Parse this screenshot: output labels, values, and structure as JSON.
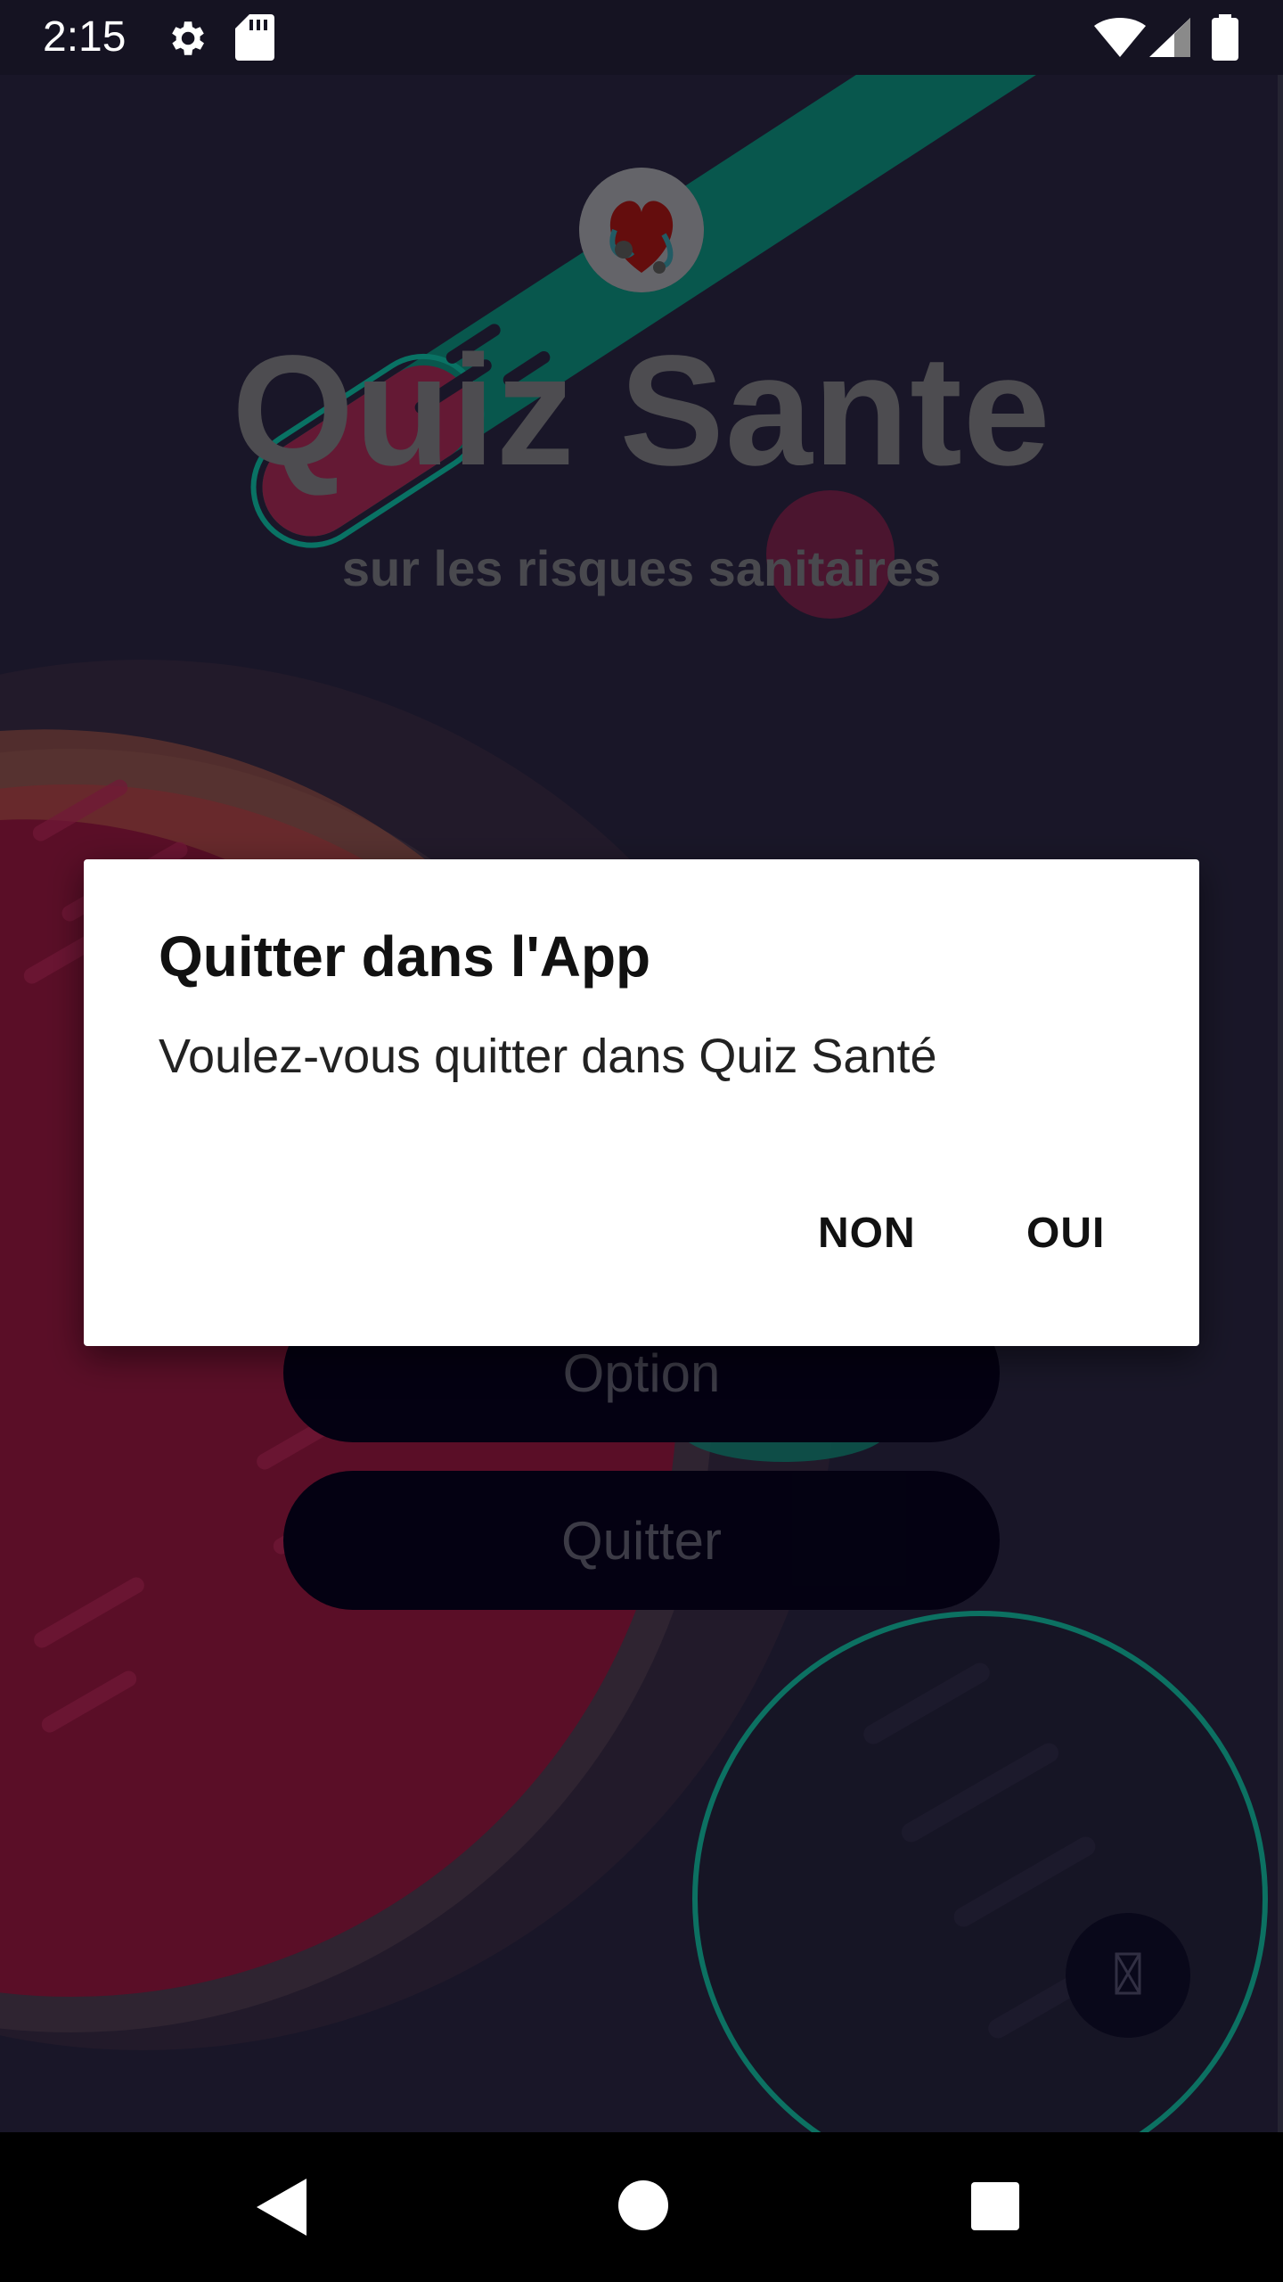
{
  "status_bar": {
    "time": "2:15",
    "icons": [
      "gear-icon",
      "sd-card-icon",
      "wifi-icon",
      "signal-icon",
      "battery-icon"
    ]
  },
  "app": {
    "title": "Quiz Sante",
    "subtitle": "sur les risques sanitaires",
    "buttons": {
      "option_label": "Option",
      "quit_label": "Quitter"
    },
    "fab_icon": "music-note-icon"
  },
  "dialog": {
    "title": "Quitter dans l'App",
    "message": "Voulez-vous quitter dans Quiz Santé",
    "negative_label": "NON",
    "positive_label": "OUI"
  },
  "nav_bar": {
    "buttons": [
      "back-icon",
      "home-icon",
      "recents-icon"
    ]
  },
  "colors": {
    "background": "#1f1c31",
    "accent_teal": "#0c7a6a",
    "accent_pink": "#8a1a3c",
    "button_bg": "#050216",
    "dialog_bg": "#ffffff"
  }
}
